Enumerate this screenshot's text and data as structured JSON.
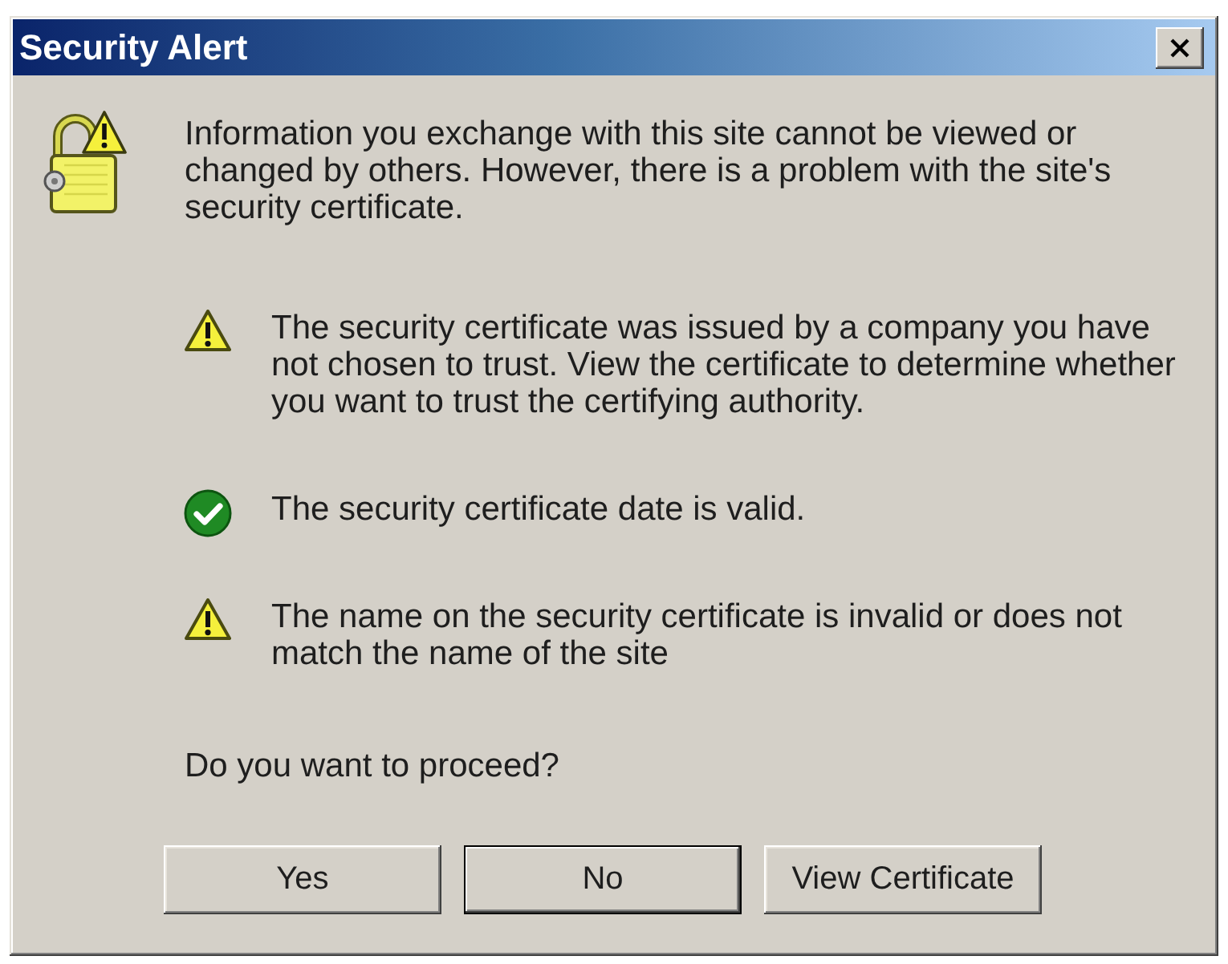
{
  "window": {
    "title": "Security Alert"
  },
  "intro": "Information you exchange with this site cannot be viewed or changed by others. However, there is a problem with the site's security certificate.",
  "checks": [
    {
      "kind": "warning",
      "text": "The security certificate was issued by a company you have not chosen to trust. View the certificate to determine whether you want to trust the certifying authority."
    },
    {
      "kind": "ok",
      "text": "The security certificate date is valid."
    },
    {
      "kind": "warning",
      "text": "The name on the security certificate is invalid or does not match the name of the site"
    }
  ],
  "question": "Do you want to proceed?",
  "buttons": [
    {
      "label": "Yes",
      "default": false
    },
    {
      "label": "No",
      "default": true
    },
    {
      "label": "View Certificate",
      "default": false
    }
  ]
}
